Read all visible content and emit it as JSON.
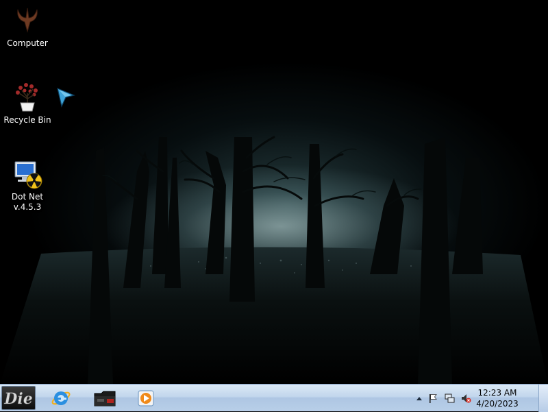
{
  "desktop": {
    "icons": [
      {
        "label": "Computer",
        "icon": "quake-logo-icon"
      },
      {
        "label": "Recycle Bin",
        "icon": "plant-pot-icon"
      },
      {
        "label": "Dot Net v.4.5.3",
        "label_line1": "Dot Net",
        "label_line2": "v.4.5.3",
        "icon": "computer-radiation-icon"
      }
    ]
  },
  "taskbar": {
    "start_icon": "die-logo-icon",
    "pinned": [
      {
        "icon": "internet-explorer-icon"
      },
      {
        "icon": "folder-icon"
      },
      {
        "icon": "media-player-icon"
      }
    ],
    "tray": {
      "icons": [
        "show-hidden-icons-chevron",
        "action-center-flag-icon",
        "network-icon",
        "volume-muted-icon"
      ],
      "time": "12:23 AM",
      "date": "4/20/2023"
    }
  },
  "colors": {
    "taskbar_top": "#dbe9f6",
    "taskbar_bottom": "#b8cfe8",
    "fog": "#c8e4e4"
  }
}
